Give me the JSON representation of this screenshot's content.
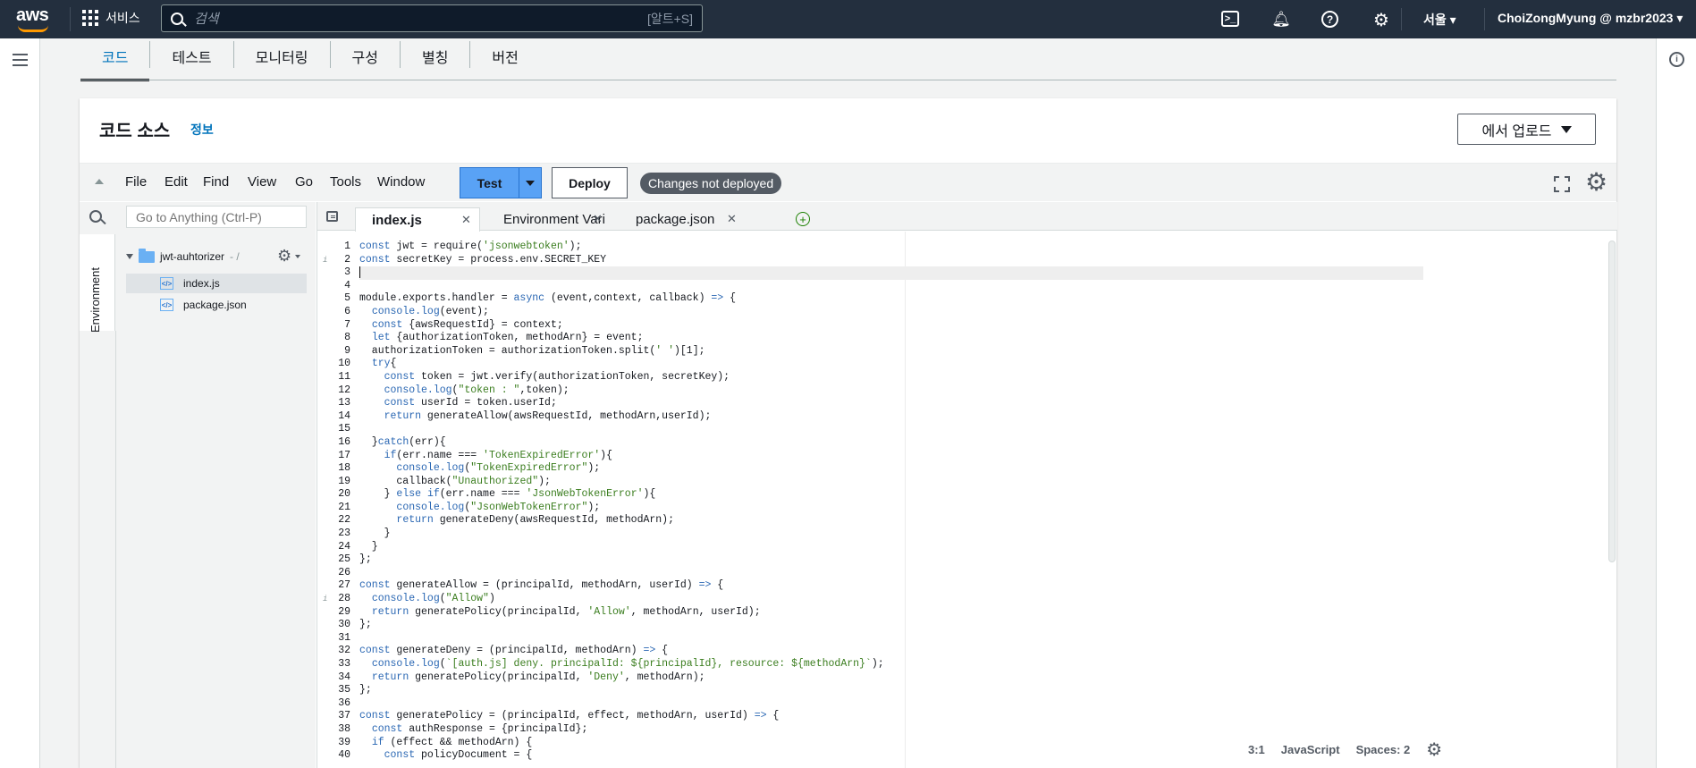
{
  "topnav": {
    "logo": "aws",
    "services_label": "서비스",
    "search_placeholder": "검색",
    "search_shortcut": "[알트+S]",
    "region": "서울",
    "account": "ChoiZongMyung @ mzbr2023",
    "icons": [
      "cloudshell-icon",
      "notifications-icon",
      "help-icon",
      "settings-icon"
    ]
  },
  "page_tabs": [
    {
      "label": "코드",
      "active": true
    },
    {
      "label": "테스트"
    },
    {
      "label": "모니터링"
    },
    {
      "label": "구성"
    },
    {
      "label": "별칭"
    },
    {
      "label": "버전"
    }
  ],
  "code_source": {
    "title": "코드 소스",
    "info_link": "정보",
    "upload_button": "에서 업로드"
  },
  "ide_menu": [
    "File",
    "Edit",
    "Find",
    "View",
    "Go",
    "Tools",
    "Window"
  ],
  "ide_buttons": {
    "test": "Test",
    "deploy": "Deploy",
    "status_badge": "Changes not deployed"
  },
  "file_tree": {
    "goto_placeholder": "Go to Anything (Ctrl-P)",
    "environment_label": "Environment",
    "folder_name": "jwt-auhtorizer",
    "folder_path": " - /",
    "files": [
      "index.js",
      "package.json"
    ],
    "selected_file": "index.js"
  },
  "editor_tabs": [
    {
      "label": "index.js",
      "active": true
    },
    {
      "label": "Environment Vari"
    },
    {
      "label": "package.json"
    }
  ],
  "code_lines": [
    "const jwt = require('jsonwebtoken');",
    "const secretKey = process.env.SECRET_KEY",
    "",
    "",
    "module.exports.handler = async (event,context, callback) => {",
    "  console.log(event);",
    "  const {awsRequestId} = context;",
    "  let {authorizationToken, methodArn} = event;",
    "  authorizationToken = authorizationToken.split(' ')[1];",
    "  try{",
    "    const token = jwt.verify(authorizationToken, secretKey);",
    "    console.log(\"token : \",token);",
    "    const userId = token.userId;",
    "    return generateAllow(awsRequestId, methodArn,userId);",
    "",
    "  }catch(err){",
    "    if(err.name === 'TokenExpiredError'){",
    "      console.log(\"TokenExpiredError\");",
    "      callback(\"Unauthorized\");",
    "    } else if(err.name === 'JsonWebTokenError'){",
    "      console.log(\"JsonWebTokenError\");",
    "      return generateDeny(awsRequestId, methodArn);",
    "    }",
    "  }",
    "};",
    "",
    "const generateAllow = (principalId, methodArn, userId) => {",
    "  console.log(\"Allow\")",
    "  return generatePolicy(principalId, 'Allow', methodArn, userId);",
    "};",
    "",
    "const generateDeny = (principalId, methodArn) => {",
    "  console.log(`[auth.js] deny. principalId: ${principalId}, resource: ${methodArn}`);",
    "  return generatePolicy(principalId, 'Deny', methodArn);",
    "};",
    "",
    "const generatePolicy = (principalId, effect, methodArn, userId) => {",
    "  const authResponse = {principalId};",
    "  if (effect && methodArn) {",
    "    const policyDocument = {"
  ],
  "warning_lines": [
    2,
    28
  ],
  "cursor_line": 3,
  "status_bar": {
    "position": "3:1",
    "language": "JavaScript",
    "spaces": "Spaces: 2"
  }
}
